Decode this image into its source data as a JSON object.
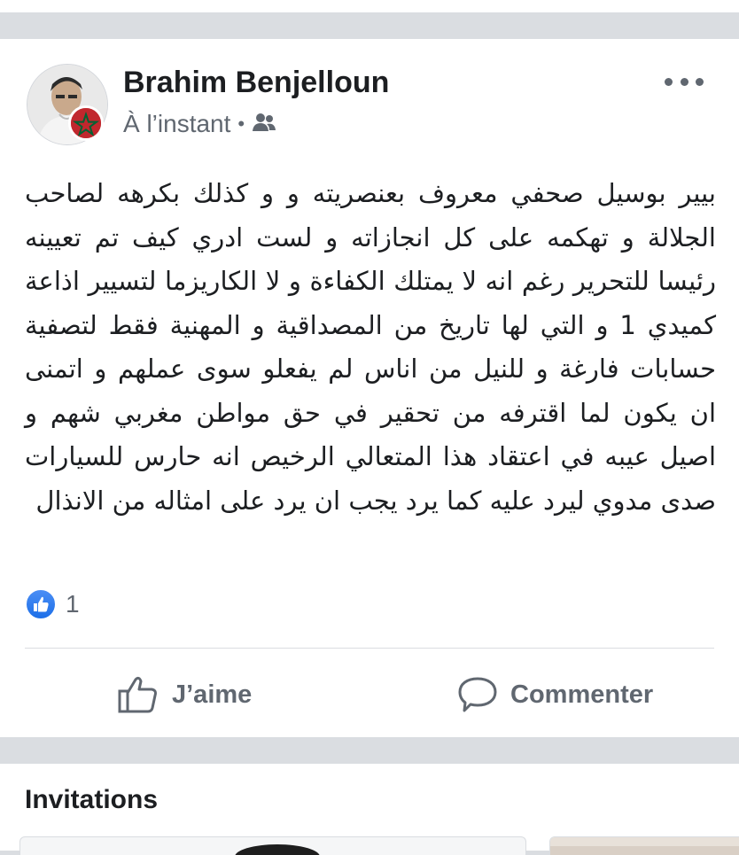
{
  "post": {
    "author": "Brahim Benjelloun",
    "timestamp": "À l’instant",
    "separator": "•",
    "audience_icon": "friends-icon",
    "more_icon": "more-options-icon",
    "text": "بيير بوسيل صحفي معروف بعنصريته و و كذلك بكرهه لصاحب الجلالة و تهكمه على كل انجازاته و لست ادري كيف تم تعيينه رئيسا للتحرير رغم انه لا يمتلك الكفاءة و لا الكاريزما لتسيير اذاعة كميدي 1 و التي لها تاريخ من المصداقية و المهنية فقط لتصفية حسابات فارغة و للنيل من اناس لم يفعلو سوى عملهم و اتمنى ان يكون لما اقترفه من تحقير في حق مواطن مغربي شهم و اصيل عيبه في اعتقاد هذا المتعالي الرخيص انه حارس للسيارات صدى مدوي ليرد عليه كما يرد يجب ان يرد على امثاله من الانذال",
    "reaction_count": "1",
    "reaction_icon": "like-reaction-icon",
    "actions": {
      "like_label": "J’aime",
      "comment_label": "Commenter"
    }
  },
  "invitations": {
    "title": "Invitations"
  },
  "colors": {
    "background": "#dadde1",
    "card": "#ffffff",
    "primary_text": "#1c1e21",
    "secondary_text": "#606770",
    "like_blue": "#1c6fe8",
    "flag_red": "#c1272d",
    "flag_green": "#006233"
  }
}
